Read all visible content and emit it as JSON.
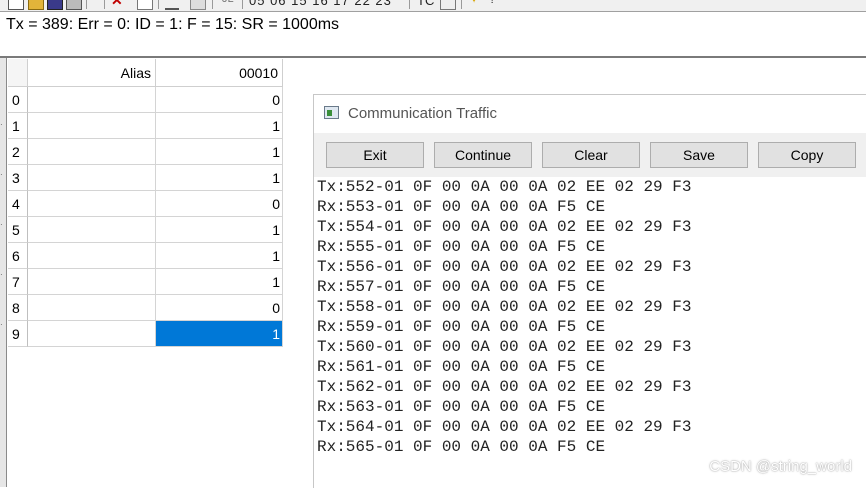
{
  "toolbar": {
    "numbers": "05 06 15 16 17 22 23",
    "tc_label": "TC"
  },
  "status": {
    "text": "Tx = 389: Err = 0: ID = 1: F = 15: SR = 1000ms"
  },
  "grid": {
    "columns": [
      "Alias",
      "00010"
    ],
    "rows": [
      {
        "label": "0",
        "alias": "",
        "value": "0"
      },
      {
        "label": "1",
        "alias": "",
        "value": "1"
      },
      {
        "label": "2",
        "alias": "",
        "value": "1"
      },
      {
        "label": "3",
        "alias": "",
        "value": "1"
      },
      {
        "label": "4",
        "alias": "",
        "value": "0"
      },
      {
        "label": "5",
        "alias": "",
        "value": "1"
      },
      {
        "label": "6",
        "alias": "",
        "value": "1"
      },
      {
        "label": "7",
        "alias": "",
        "value": "1"
      },
      {
        "label": "8",
        "alias": "",
        "value": "0"
      },
      {
        "label": "9",
        "alias": "",
        "value": "1"
      }
    ],
    "selected_row": 9,
    "selection_color": "#0078d7"
  },
  "traffic": {
    "title": "Communication Traffic",
    "buttons": [
      "Exit",
      "Continue",
      "Clear",
      "Save",
      "Copy"
    ],
    "log": [
      "Tx:552-01 0F 00 0A 00 0A 02 EE 02 29 F3",
      "Rx:553-01 0F 00 0A 00 0A F5 CE",
      "Tx:554-01 0F 00 0A 00 0A 02 EE 02 29 F3",
      "Rx:555-01 0F 00 0A 00 0A F5 CE",
      "Tx:556-01 0F 00 0A 00 0A 02 EE 02 29 F3",
      "Rx:557-01 0F 00 0A 00 0A F5 CE",
      "Tx:558-01 0F 00 0A 00 0A 02 EE 02 29 F3",
      "Rx:559-01 0F 00 0A 00 0A F5 CE",
      "Tx:560-01 0F 00 0A 00 0A 02 EE 02 29 F3",
      "Rx:561-01 0F 00 0A 00 0A F5 CE",
      "Tx:562-01 0F 00 0A 00 0A 02 EE 02 29 F3",
      "Rx:563-01 0F 00 0A 00 0A F5 CE",
      "Tx:564-01 0F 00 0A 00 0A 02 EE 02 29 F3",
      "Rx:565-01 0F 00 0A 00 0A F5 CE"
    ]
  },
  "watermark": "CSDN @string_world"
}
